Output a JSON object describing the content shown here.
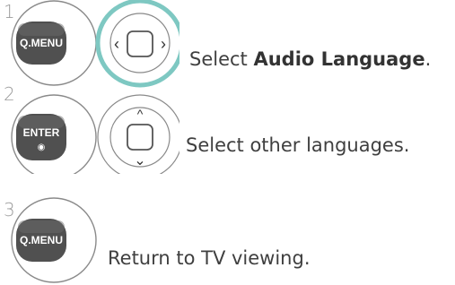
{
  "steps": [
    {
      "number": "1",
      "key_label": "Q.MENU",
      "text_plain": "Select ",
      "text_bold": "Audio Language",
      "text_suffix": "."
    },
    {
      "number": "2",
      "key_label": "ENTER",
      "key_sub": "◉",
      "text": "Select other languages."
    },
    {
      "number": "3",
      "key_label": "Q.MENU",
      "text": "Return to TV viewing."
    }
  ],
  "nav_glyphs": {
    "left": "‹",
    "right": "›",
    "up": "^",
    "down": "⌄"
  },
  "colors": {
    "highlight_ring": "#7ec8c2",
    "key_fill": "#505050",
    "ring_stroke": "#8a8a8a"
  }
}
